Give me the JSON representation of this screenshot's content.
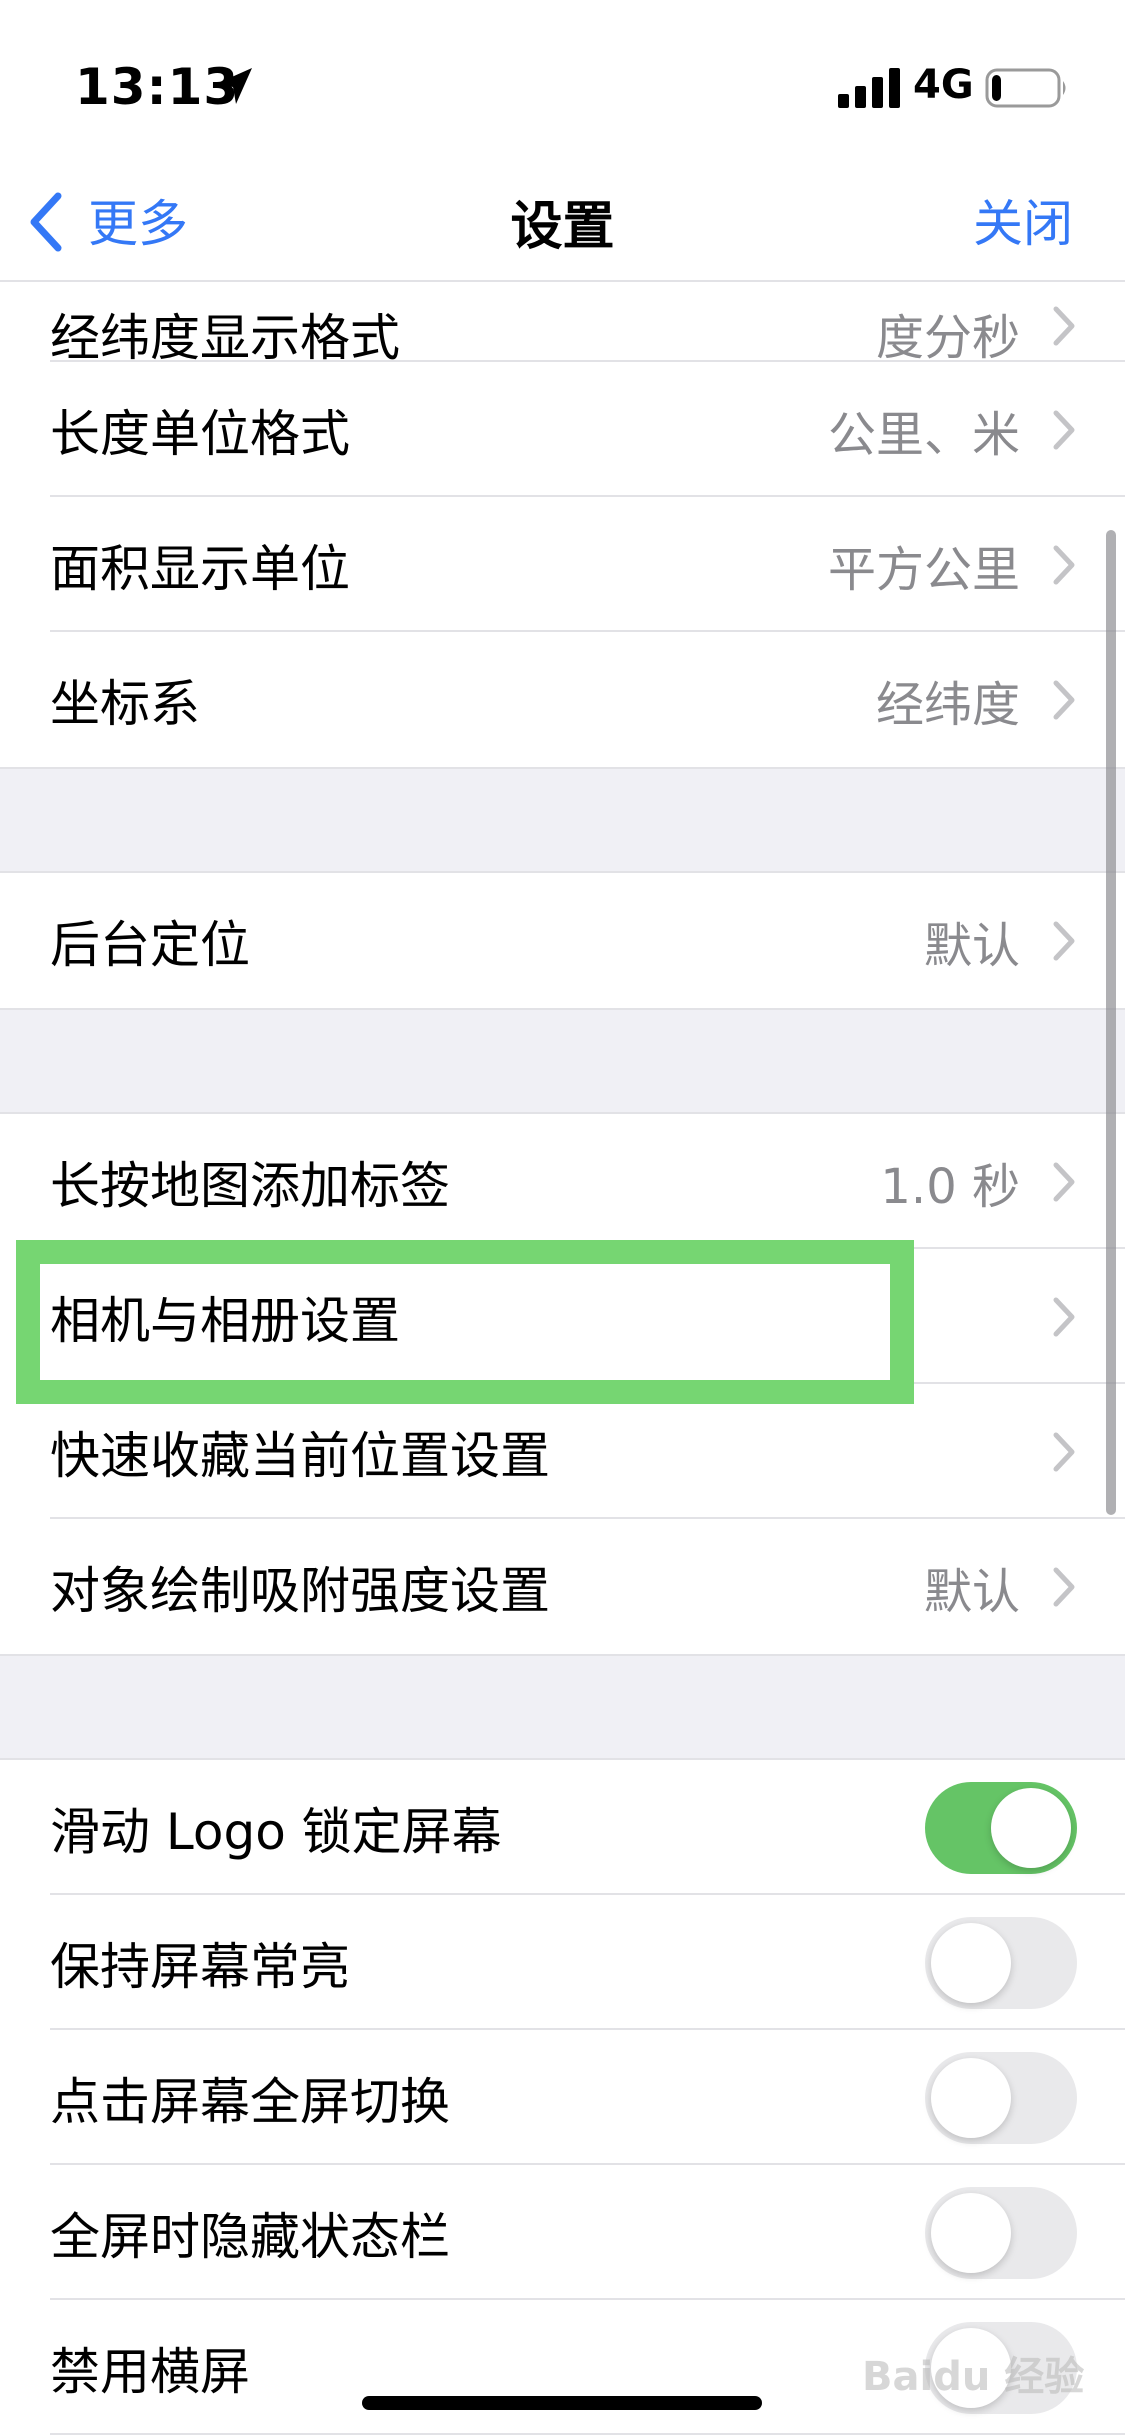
{
  "status_bar": {
    "time": "13:13",
    "network": "4G",
    "battery_level": 0.15
  },
  "nav": {
    "back_label": "更多",
    "title": "设置",
    "close_label": "关闭"
  },
  "rows": {
    "latlng_format": {
      "label": "经纬度显示格式",
      "value": "度分秒"
    },
    "length_unit": {
      "label": "长度单位格式",
      "value": "公里、米"
    },
    "area_unit": {
      "label": "面积显示单位",
      "value": "平方公里"
    },
    "coord_system": {
      "label": "坐标系",
      "value": "经纬度"
    },
    "background_location": {
      "label": "后台定位",
      "value": "默认"
    },
    "long_press": {
      "label": "长按地图添加标签",
      "value": "1.0 秒"
    },
    "camera_album": {
      "label": "相机与相册设置"
    },
    "quick_favorite": {
      "label": "快速收藏当前位置设置"
    },
    "snap_strength": {
      "label": "对象绘制吸附强度设置",
      "value": "默认"
    },
    "slide_logo_lock": {
      "label": "滑动 Logo 锁定屏幕",
      "enabled": true
    },
    "keep_screen_on": {
      "label": "保持屏幕常亮",
      "enabled": false
    },
    "tap_fullscreen": {
      "label": "点击屏幕全屏切换",
      "enabled": false
    },
    "hide_status_bar": {
      "label": "全屏时隐藏状态栏",
      "enabled": false
    },
    "disable_landscape": {
      "label": "禁用横屏",
      "enabled": false
    }
  },
  "watermark": {
    "text": "Baidu 经验"
  },
  "colors": {
    "accent": "#3478f6",
    "toggle_on": "#65c466",
    "highlight": "#76d672",
    "secondary_text": "#8a8a8e",
    "group_background": "#f0f0f5"
  }
}
